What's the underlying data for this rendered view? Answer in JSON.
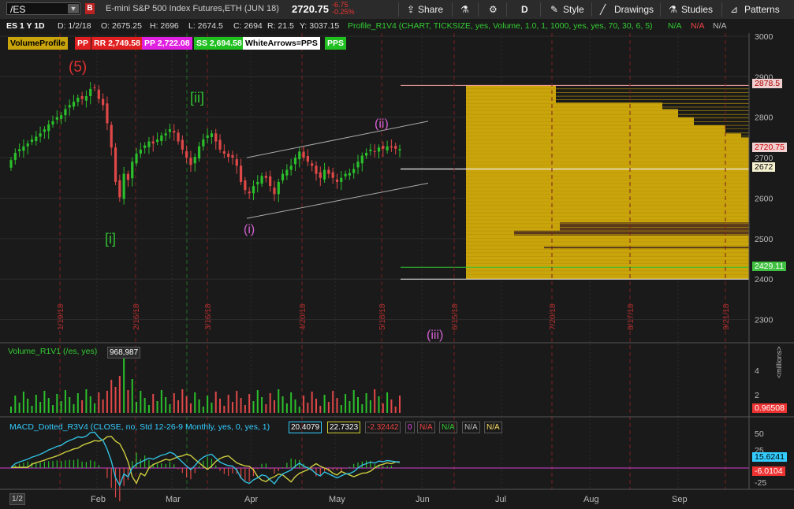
{
  "toolbar": {
    "symbol": "/ES",
    "badge": "B",
    "description": "E-mini S&P 500 Index Futures,ETH (JUN 18)",
    "last_price": "2720.75",
    "net_change": "-6.75",
    "pct_change": "-0.25%",
    "share": "Share",
    "aggregation": "D",
    "style": "Style",
    "drawings": "Drawings",
    "studies": "Studies",
    "patterns": "Patterns"
  },
  "info_bar": {
    "period": "ES 1 Y 1D",
    "date": "D: 1/2/18",
    "open": "O: 2675.25",
    "high": "H: 2696",
    "low": "L: 2674.5",
    "close": "C: 2694",
    "range": "R: 21.5",
    "y": "Y: 3037.15",
    "profile": "Profile_R1V4 (CHART, TICKSIZE, yes, Volume, 1.0, 1, 1000, yes, yes, 70, 30, 6, 5)",
    "na1": "N/A",
    "na2": "N/A",
    "na3": "N/A"
  },
  "study_labels": {
    "volume_profile": "VolumeProfile",
    "pp": "PP",
    "rr": "RR 2,749.58",
    "pp2": "PP 2,722.08",
    "ss": "SS 2,694.58",
    "white_arrows": "WhiteArrows=PPS",
    "pps": "PPS"
  },
  "wave_labels": {
    "w5": "(5)",
    "wi": "[i]",
    "wii": "[ii]",
    "ci": "(i)",
    "cii": "(ii)",
    "ciii": "(iii)"
  },
  "price_axis": {
    "ticks": [
      "3000",
      "2900",
      "2800",
      "2700",
      "2600",
      "2500",
      "2400",
      "2300"
    ],
    "tag_2878": "2878.5",
    "tag_2720": "2720.75",
    "tag_2672": "2672",
    "tag_2429": "2429.11"
  },
  "vertical_dates": [
    "1/19/18",
    "2/16/18",
    "3/16/18",
    "4/20/18",
    "5/18/18",
    "6/15/18",
    "7/20/18",
    "8/17/18",
    "9/21/18"
  ],
  "volume_panel": {
    "label": "Volume_R1V1 (/es, yes)",
    "value": "968,987",
    "ticks": [
      "4",
      "2"
    ],
    "tag": "0.96508",
    "unit": "<millions>"
  },
  "macd_panel": {
    "label": "MACD_Dotted_R3V4 (CLOSE, no, Std 12-26-9 Monthly, yes, 0, yes, 1)",
    "v1": "20.4079",
    "v2": "22.7323",
    "v3": "-2.32442",
    "zero": "0",
    "na1": "N/A",
    "na2": "N/A",
    "na3": "N/A",
    "na4": "N/A",
    "ticks": [
      "50",
      "25",
      "-25"
    ],
    "tag1": "15.6241",
    "tag2": "-6.0104"
  },
  "time_axis": {
    "page": "1/2",
    "months": [
      "Feb",
      "Mar",
      "Apr",
      "May",
      "Jun",
      "Jul",
      "Aug",
      "Sep"
    ]
  },
  "colors": {
    "up": "#2bbf2b",
    "down": "#e04848",
    "profile": "#c9a40b",
    "profile_dark": "#5a3a1a",
    "background": "#1a1a1a"
  },
  "chart_data": {
    "type": "candlestick",
    "title": "E-mini S&P 500 Index Futures,ETH (JUN 18)",
    "ylim": [
      2250,
      3020
    ],
    "y_ticks": [
      3000,
      2900,
      2800,
      2700,
      2600,
      2500,
      2400,
      2300
    ],
    "channel": {
      "upper": [
        [
          2616,
          2700
        ],
        [
          2788,
          2790
        ]
      ],
      "lower": [
        [
          2612,
          2550
        ],
        [
          2788,
          2637
        ]
      ]
    },
    "levels": {
      "top": 2878.5,
      "last": 2720.75,
      "white": 2672,
      "green": 2429.11,
      "bottom": 2400
    },
    "closes": [
      2694,
      2712,
      2721,
      2728,
      2735,
      2745,
      2752,
      2760,
      2770,
      2782,
      2790,
      2800,
      2805,
      2820,
      2830,
      2838,
      2848,
      2845,
      2852,
      2870,
      2872,
      2845,
      2830,
      2785,
      2725,
      2640,
      2602,
      2660,
      2645,
      2690,
      2710,
      2720,
      2730,
      2740,
      2735,
      2745,
      2755,
      2760,
      2770,
      2762,
      2740,
      2720,
      2700,
      2682,
      2702,
      2728,
      2745,
      2755,
      2760,
      2740,
      2720,
      2710,
      2702,
      2700,
      2680,
      2640,
      2620,
      2612,
      2630,
      2640,
      2655,
      2650,
      2630,
      2610,
      2640,
      2660,
      2670,
      2680,
      2700,
      2715,
      2700,
      2690,
      2680,
      2660,
      2650,
      2670,
      2660,
      2650,
      2640,
      2650,
      2660,
      2662,
      2672,
      2690,
      2705,
      2712,
      2720,
      2715,
      2725,
      2722,
      2728,
      2725,
      2722,
      2721
    ]
  }
}
